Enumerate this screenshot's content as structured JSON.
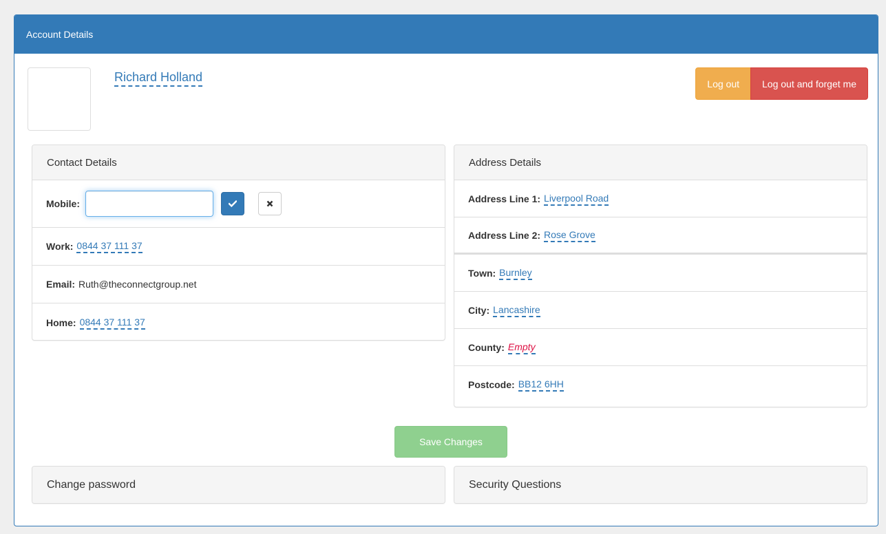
{
  "header": {
    "title": "Account Details"
  },
  "user": {
    "name": "Richard Holland"
  },
  "actions": {
    "logout": "Log out",
    "logout_forget": "Log out and forget me",
    "save": "Save Changes"
  },
  "contact": {
    "title": "Contact Details",
    "mobile_label": "Mobile:",
    "mobile_value": "",
    "work_label": "Work:",
    "work_value": "0844 37 111 37",
    "email_label": "Email:",
    "email_value": "Ruth@theconnectgroup.net",
    "home_label": "Home:",
    "home_value": "0844 37 111 37"
  },
  "address": {
    "title": "Address Details",
    "line1_label": "Address Line 1:",
    "line1_value": "Liverpool Road",
    "line2_label": "Address Line 2:",
    "line2_value": "Rose Grove",
    "town_label": "Town:",
    "town_value": "Burnley",
    "city_label": "City:",
    "city_value": "Lancashire",
    "county_label": "County:",
    "county_value": "Empty",
    "postcode_label": "Postcode:",
    "postcode_value": "BB12 6HH"
  },
  "sections": {
    "password": "Change password",
    "security": "Security Questions"
  },
  "icons": {
    "confirm": "check-icon",
    "cancel": "close-icon"
  },
  "colors": {
    "primary": "#337ab7",
    "warning": "#f0ad4e",
    "danger": "#d9534f",
    "success_disabled": "#8fd08f",
    "empty": "#dd1144"
  }
}
